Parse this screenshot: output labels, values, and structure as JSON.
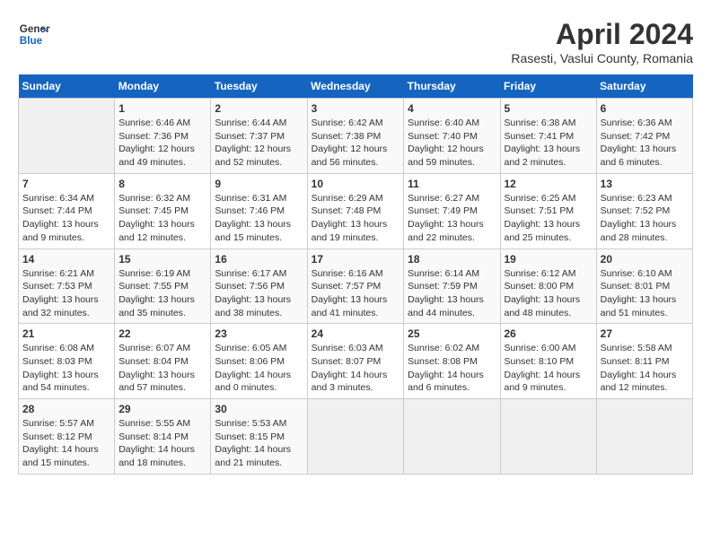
{
  "header": {
    "logo_general": "General",
    "logo_blue": "Blue",
    "title": "April 2024",
    "subtitle": "Rasesti, Vaslui County, Romania"
  },
  "days_of_week": [
    "Sunday",
    "Monday",
    "Tuesday",
    "Wednesday",
    "Thursday",
    "Friday",
    "Saturday"
  ],
  "weeks": [
    [
      {
        "num": "",
        "info": ""
      },
      {
        "num": "1",
        "info": "Sunrise: 6:46 AM\nSunset: 7:36 PM\nDaylight: 12 hours\nand 49 minutes."
      },
      {
        "num": "2",
        "info": "Sunrise: 6:44 AM\nSunset: 7:37 PM\nDaylight: 12 hours\nand 52 minutes."
      },
      {
        "num": "3",
        "info": "Sunrise: 6:42 AM\nSunset: 7:38 PM\nDaylight: 12 hours\nand 56 minutes."
      },
      {
        "num": "4",
        "info": "Sunrise: 6:40 AM\nSunset: 7:40 PM\nDaylight: 12 hours\nand 59 minutes."
      },
      {
        "num": "5",
        "info": "Sunrise: 6:38 AM\nSunset: 7:41 PM\nDaylight: 13 hours\nand 2 minutes."
      },
      {
        "num": "6",
        "info": "Sunrise: 6:36 AM\nSunset: 7:42 PM\nDaylight: 13 hours\nand 6 minutes."
      }
    ],
    [
      {
        "num": "7",
        "info": "Sunrise: 6:34 AM\nSunset: 7:44 PM\nDaylight: 13 hours\nand 9 minutes."
      },
      {
        "num": "8",
        "info": "Sunrise: 6:32 AM\nSunset: 7:45 PM\nDaylight: 13 hours\nand 12 minutes."
      },
      {
        "num": "9",
        "info": "Sunrise: 6:31 AM\nSunset: 7:46 PM\nDaylight: 13 hours\nand 15 minutes."
      },
      {
        "num": "10",
        "info": "Sunrise: 6:29 AM\nSunset: 7:48 PM\nDaylight: 13 hours\nand 19 minutes."
      },
      {
        "num": "11",
        "info": "Sunrise: 6:27 AM\nSunset: 7:49 PM\nDaylight: 13 hours\nand 22 minutes."
      },
      {
        "num": "12",
        "info": "Sunrise: 6:25 AM\nSunset: 7:51 PM\nDaylight: 13 hours\nand 25 minutes."
      },
      {
        "num": "13",
        "info": "Sunrise: 6:23 AM\nSunset: 7:52 PM\nDaylight: 13 hours\nand 28 minutes."
      }
    ],
    [
      {
        "num": "14",
        "info": "Sunrise: 6:21 AM\nSunset: 7:53 PM\nDaylight: 13 hours\nand 32 minutes."
      },
      {
        "num": "15",
        "info": "Sunrise: 6:19 AM\nSunset: 7:55 PM\nDaylight: 13 hours\nand 35 minutes."
      },
      {
        "num": "16",
        "info": "Sunrise: 6:17 AM\nSunset: 7:56 PM\nDaylight: 13 hours\nand 38 minutes."
      },
      {
        "num": "17",
        "info": "Sunrise: 6:16 AM\nSunset: 7:57 PM\nDaylight: 13 hours\nand 41 minutes."
      },
      {
        "num": "18",
        "info": "Sunrise: 6:14 AM\nSunset: 7:59 PM\nDaylight: 13 hours\nand 44 minutes."
      },
      {
        "num": "19",
        "info": "Sunrise: 6:12 AM\nSunset: 8:00 PM\nDaylight: 13 hours\nand 48 minutes."
      },
      {
        "num": "20",
        "info": "Sunrise: 6:10 AM\nSunset: 8:01 PM\nDaylight: 13 hours\nand 51 minutes."
      }
    ],
    [
      {
        "num": "21",
        "info": "Sunrise: 6:08 AM\nSunset: 8:03 PM\nDaylight: 13 hours\nand 54 minutes."
      },
      {
        "num": "22",
        "info": "Sunrise: 6:07 AM\nSunset: 8:04 PM\nDaylight: 13 hours\nand 57 minutes."
      },
      {
        "num": "23",
        "info": "Sunrise: 6:05 AM\nSunset: 8:06 PM\nDaylight: 14 hours\nand 0 minutes."
      },
      {
        "num": "24",
        "info": "Sunrise: 6:03 AM\nSunset: 8:07 PM\nDaylight: 14 hours\nand 3 minutes."
      },
      {
        "num": "25",
        "info": "Sunrise: 6:02 AM\nSunset: 8:08 PM\nDaylight: 14 hours\nand 6 minutes."
      },
      {
        "num": "26",
        "info": "Sunrise: 6:00 AM\nSunset: 8:10 PM\nDaylight: 14 hours\nand 9 minutes."
      },
      {
        "num": "27",
        "info": "Sunrise: 5:58 AM\nSunset: 8:11 PM\nDaylight: 14 hours\nand 12 minutes."
      }
    ],
    [
      {
        "num": "28",
        "info": "Sunrise: 5:57 AM\nSunset: 8:12 PM\nDaylight: 14 hours\nand 15 minutes."
      },
      {
        "num": "29",
        "info": "Sunrise: 5:55 AM\nSunset: 8:14 PM\nDaylight: 14 hours\nand 18 minutes."
      },
      {
        "num": "30",
        "info": "Sunrise: 5:53 AM\nSunset: 8:15 PM\nDaylight: 14 hours\nand 21 minutes."
      },
      {
        "num": "",
        "info": ""
      },
      {
        "num": "",
        "info": ""
      },
      {
        "num": "",
        "info": ""
      },
      {
        "num": "",
        "info": ""
      }
    ]
  ]
}
